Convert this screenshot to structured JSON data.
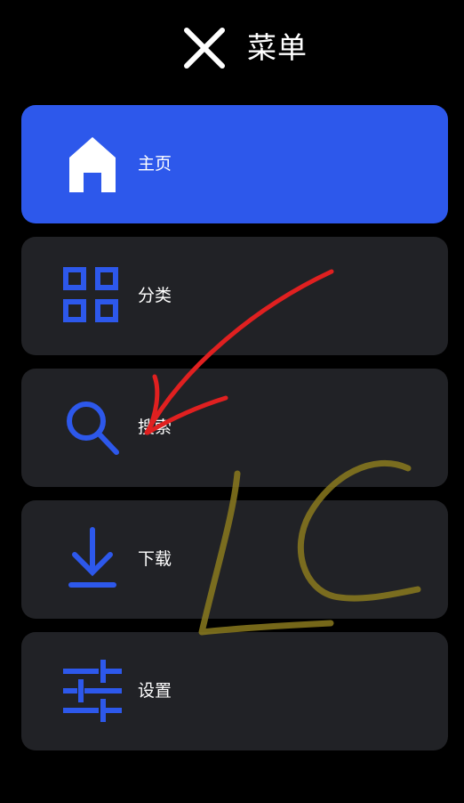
{
  "header": {
    "title": "菜单",
    "close_icon": "close-icon"
  },
  "menu": {
    "items": [
      {
        "label": "主页",
        "icon": "home-icon",
        "active": true
      },
      {
        "label": "分类",
        "icon": "grid-icon",
        "active": false
      },
      {
        "label": "搜索",
        "icon": "search-icon",
        "active": false
      },
      {
        "label": "下载",
        "icon": "download-icon",
        "active": false
      },
      {
        "label": "设置",
        "icon": "sliders-icon",
        "active": false
      }
    ]
  },
  "colors": {
    "background": "#000000",
    "accent": "#2D58EB",
    "card": "#212226",
    "text": "#FFFFFF",
    "icon": "#2D58EB",
    "annotation_arrow": "#E02020",
    "annotation_scribble": "#8A7A1E"
  }
}
